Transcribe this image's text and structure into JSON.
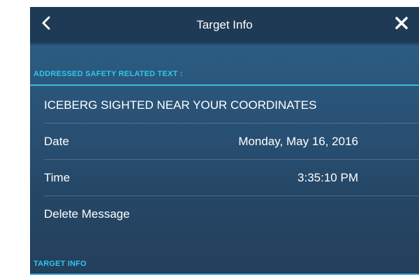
{
  "header": {
    "title": "Target Info",
    "back_icon": "chevron-left-icon",
    "close_icon": "close-icon"
  },
  "sections": {
    "safety_text": {
      "heading": "ADDRESSED SAFETY RELATED TEXT :",
      "message": "ICEBERG SIGHTED NEAR YOUR COORDINATES",
      "date_label": "Date",
      "date_value": "Monday, May 16, 2016",
      "time_label": "Time",
      "time_value": "3:35:10 PM",
      "delete_label": "Delete Message"
    },
    "target_info": {
      "heading": "TARGET INFO"
    }
  },
  "colors": {
    "accent": "#2fc7ee",
    "titlebar": "#1f3a54",
    "panel_top": "#2e6189",
    "panel_bottom": "#233f5b"
  }
}
